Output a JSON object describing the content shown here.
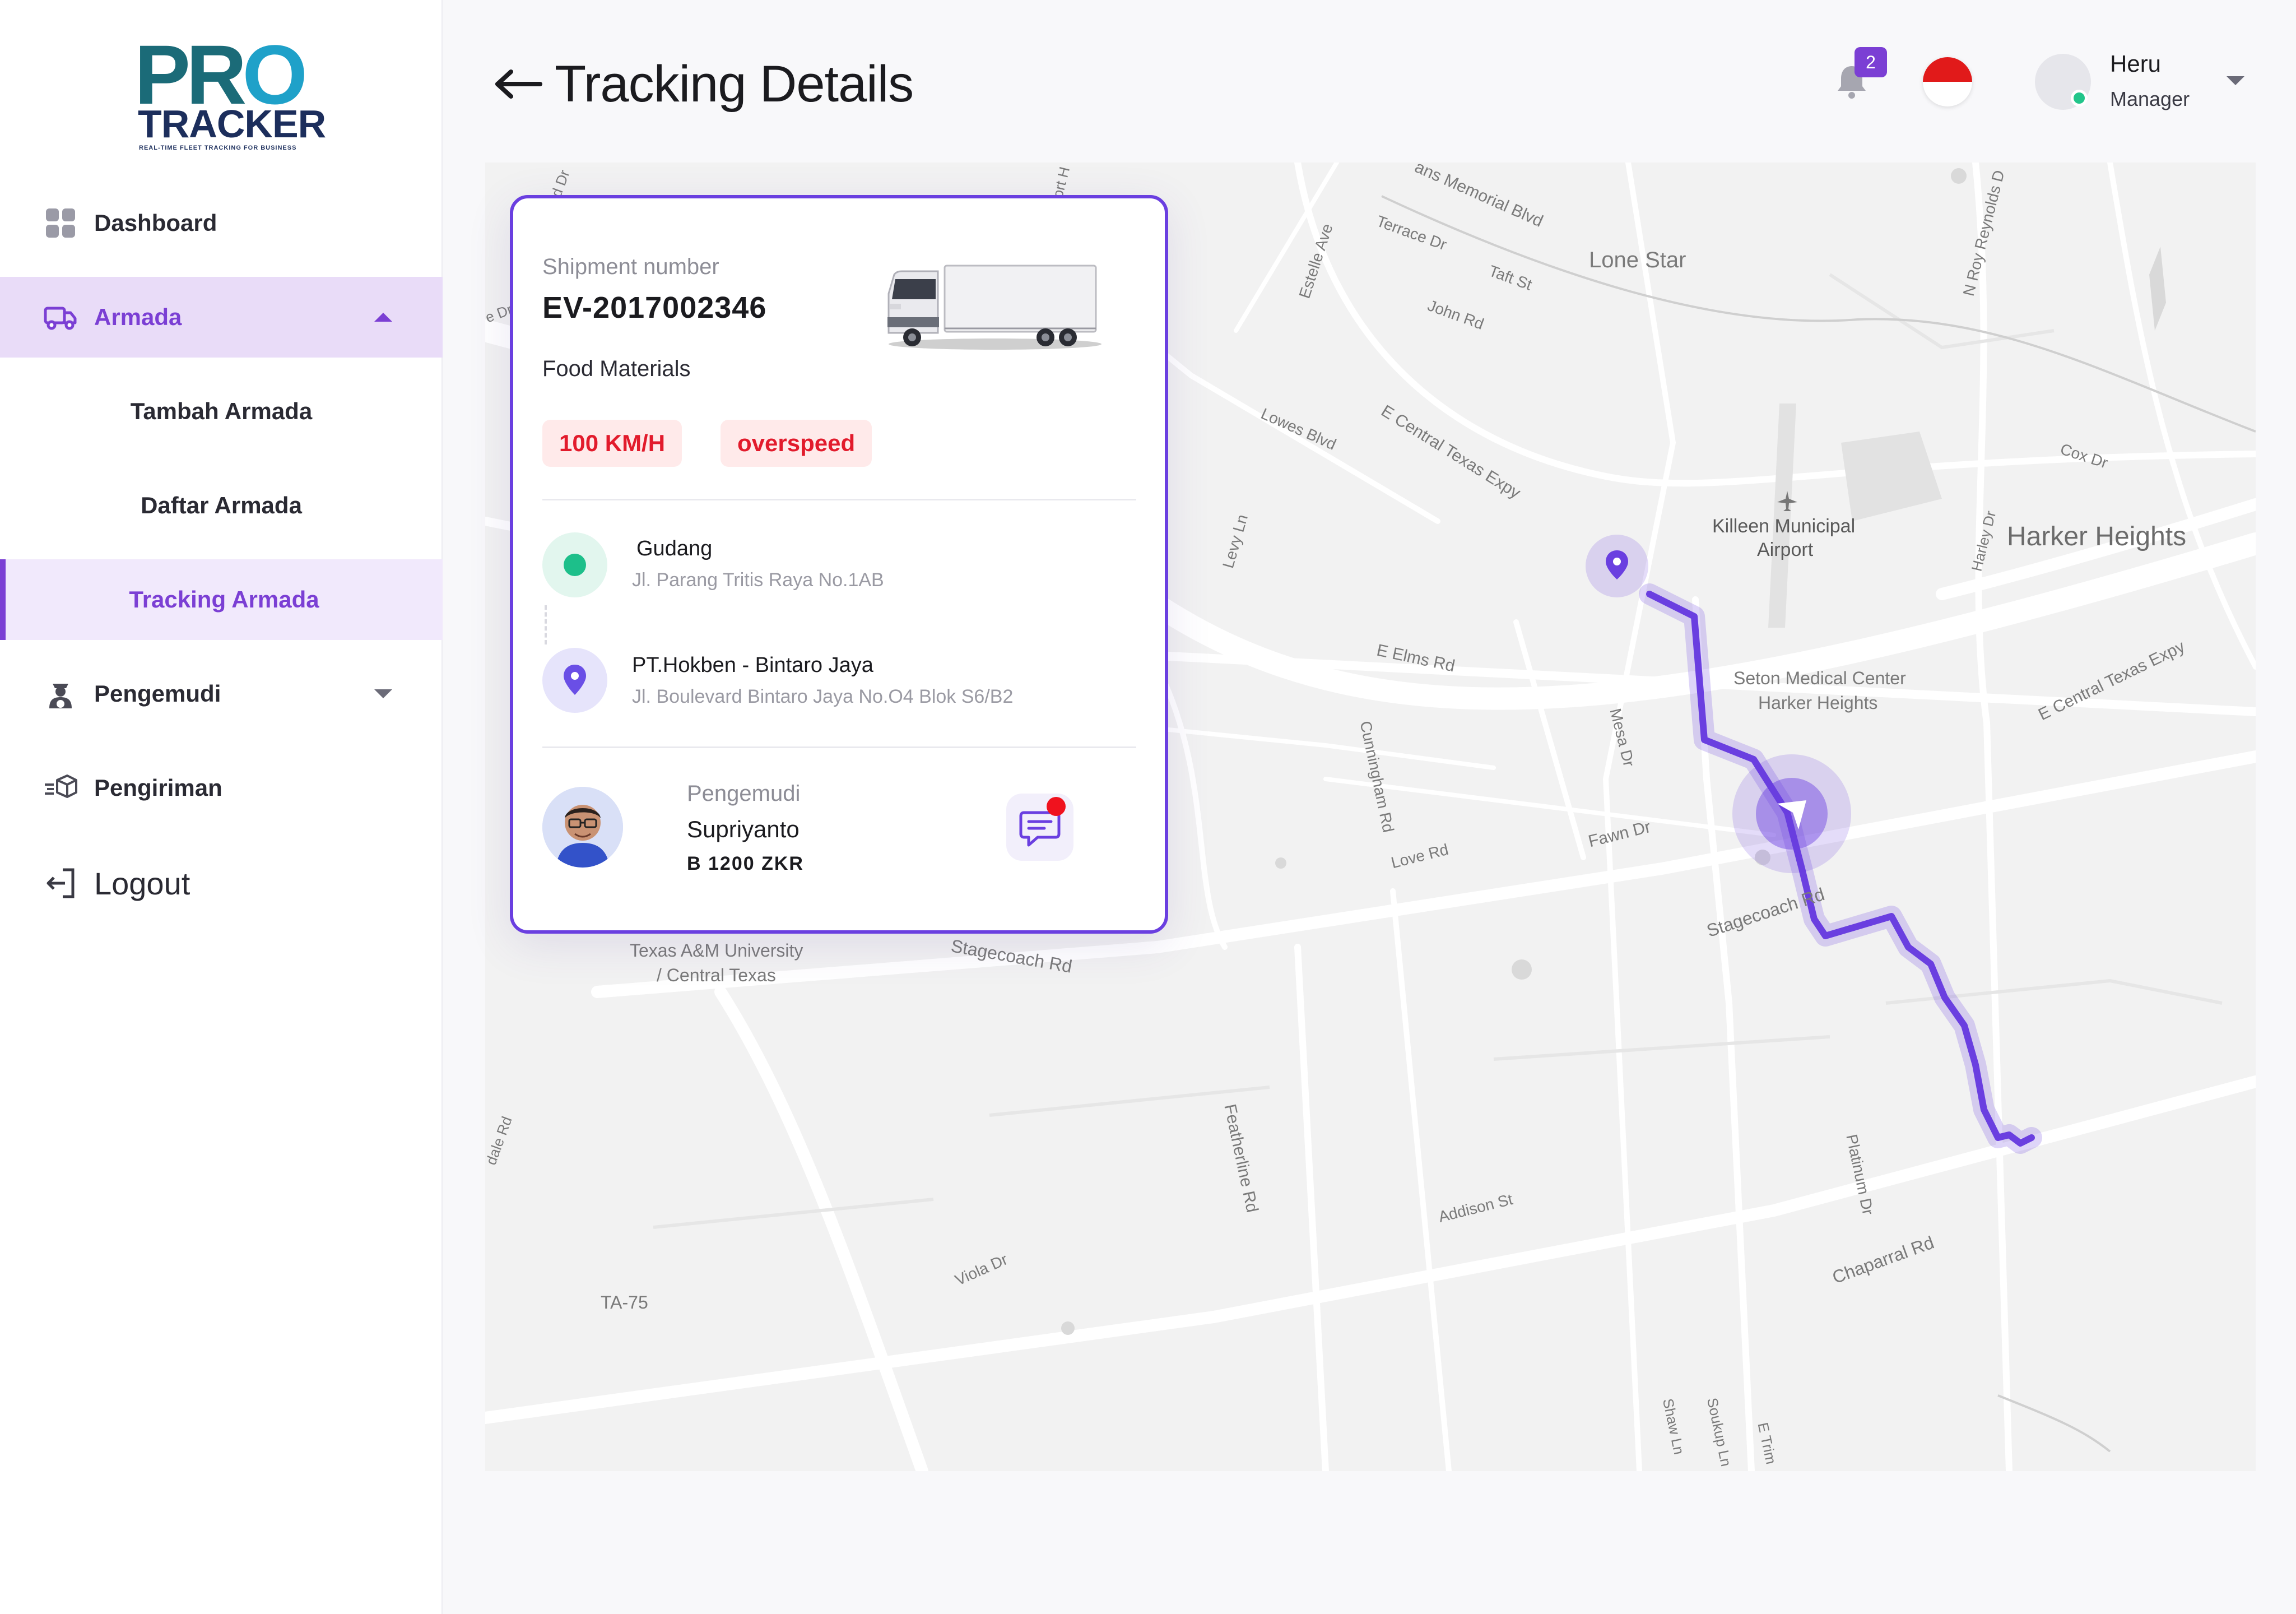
{
  "app": {
    "logo": {
      "pro": "PRO",
      "tracker": "TRACKER",
      "tagline": "REAL-TIME FLEET TRACKING FOR BUSINESS"
    }
  },
  "sidebar": {
    "items": [
      {
        "label": "Dashboard",
        "icon": "dashboard-grid-icon"
      },
      {
        "label": "Armada",
        "icon": "truck-icon",
        "expanded": true,
        "children": [
          {
            "label": "Tambah Armada"
          },
          {
            "label": "Daftar Armada"
          },
          {
            "label": "Tracking Armada",
            "active": true
          }
        ]
      },
      {
        "label": "Pengemudi",
        "icon": "driver-icon"
      },
      {
        "label": "Pengiriman",
        "icon": "shipping-box-icon"
      },
      {
        "label": "Logout",
        "icon": "logout-icon"
      }
    ]
  },
  "header": {
    "title": "Tracking Details",
    "notifications": {
      "count": "2",
      "icon": "bell-icon"
    },
    "language_flag": "indonesia-flag",
    "user": {
      "name": "Heru",
      "role": "Manager",
      "status_color": "#22c58a"
    }
  },
  "shipment": {
    "number_label": "Shipment number",
    "number": "EV-2017002346",
    "cargo": "Food Materials",
    "speed": "100 KM/H",
    "status": "overspeed",
    "origin": {
      "name": "Gudang",
      "address": "Jl. Parang Tritis Raya No.1AB"
    },
    "destination": {
      "name": "PT.Hokben - Bintaro Jaya",
      "address": "Jl. Boulevard Bintaro Jaya No.O4 Blok S6/B2"
    },
    "driver": {
      "label": "Pengemudi",
      "name": "Supriyanto",
      "plate": "B 1200 ZKR"
    }
  },
  "map": {
    "labels": {
      "lone_star": "Lone Star",
      "harker_heights": "Harker Heights",
      "airport": "Killeen Municipal",
      "airport2": "Airport",
      "seton": "Seton Medical Center",
      "seton2": "Harker Heights",
      "texas_am": "Texas A&M University",
      "texas_am2": "/ Central Texas",
      "ta75": "TA-75",
      "e_central": "E Central Texas Expy",
      "e_central2": "E Central Texas Expy",
      "e_elms": "E Elms Rd",
      "fawn": "Fawn Dr",
      "love": "Love Rd",
      "stagecoach": "Stagecoach Rd",
      "stagecoach2": "Stagecoach Rd",
      "chaparral": "Chaparral Rd",
      "addison": "Addison St",
      "viola": "Viola Dr",
      "featherline": "Featherline Rd",
      "cunningham": "Cunningham Rd",
      "mesa": "Mesa Dr",
      "platinum": "Platinum Dr",
      "lowes": "Lowes Blvd",
      "levy": "Levy Ln",
      "estelle": "Estelle Ave",
      "terrace": "Terrace Dr",
      "taft": "Taft St",
      "john": "John Rd",
      "memorial": "ans Memorial Blvd",
      "cox": "Cox Dr",
      "harley": "Harley Dr",
      "roy": "N Roy Reynolds D",
      "shaw": "Shaw Ln",
      "soukup": "Soukup Ln",
      "etrim": "E Trim",
      "dale": "dale Rd",
      "edge_dr": "d Dr",
      "edge_dr2": "e Dr",
      "edge_h": "ort H"
    },
    "route_color": "#6a3fe0"
  }
}
